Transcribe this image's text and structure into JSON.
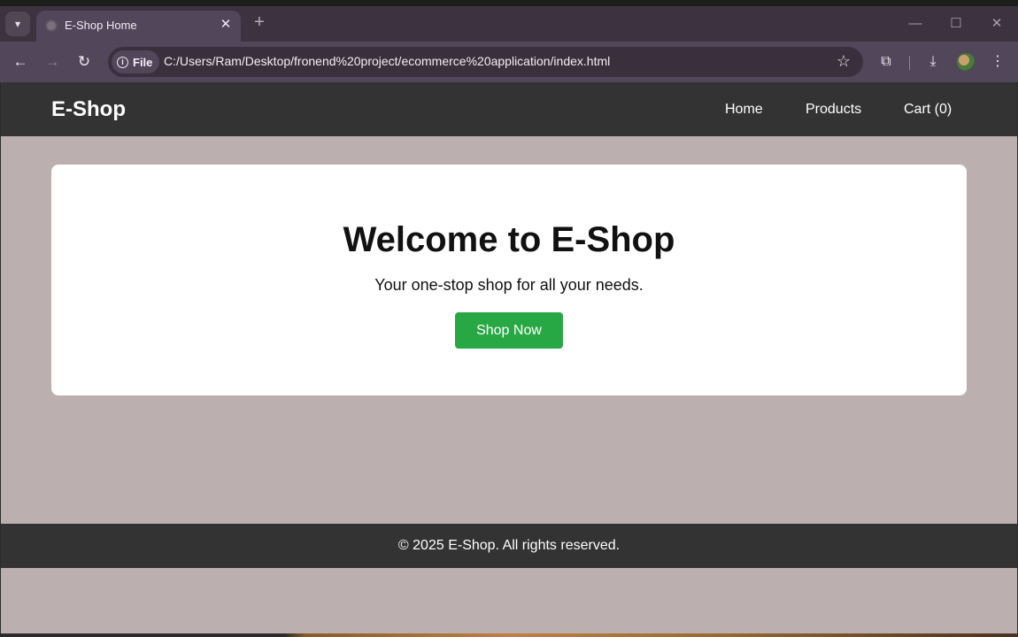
{
  "browser": {
    "tab_title": "E-Shop Home",
    "new_tab_icon": "plus-icon",
    "address_chip": "File",
    "url": "C:/Users/Ram/Desktop/fronend%20project/ecommerce%20application/index.html"
  },
  "site": {
    "brand": "E-Shop",
    "nav": [
      {
        "label": "Home"
      },
      {
        "label": "Products"
      },
      {
        "label": "Cart (0)"
      }
    ],
    "hero": {
      "title": "Welcome to E-Shop",
      "subtitle": "Your one-stop shop for all your needs.",
      "cta": "Shop Now"
    },
    "footer": "© 2025 E-Shop. All rights reserved."
  },
  "colors": {
    "header_bg": "#333333",
    "page_bg": "#bbb0af",
    "cta_bg": "#28a745",
    "browser_frame": "#51465a"
  }
}
